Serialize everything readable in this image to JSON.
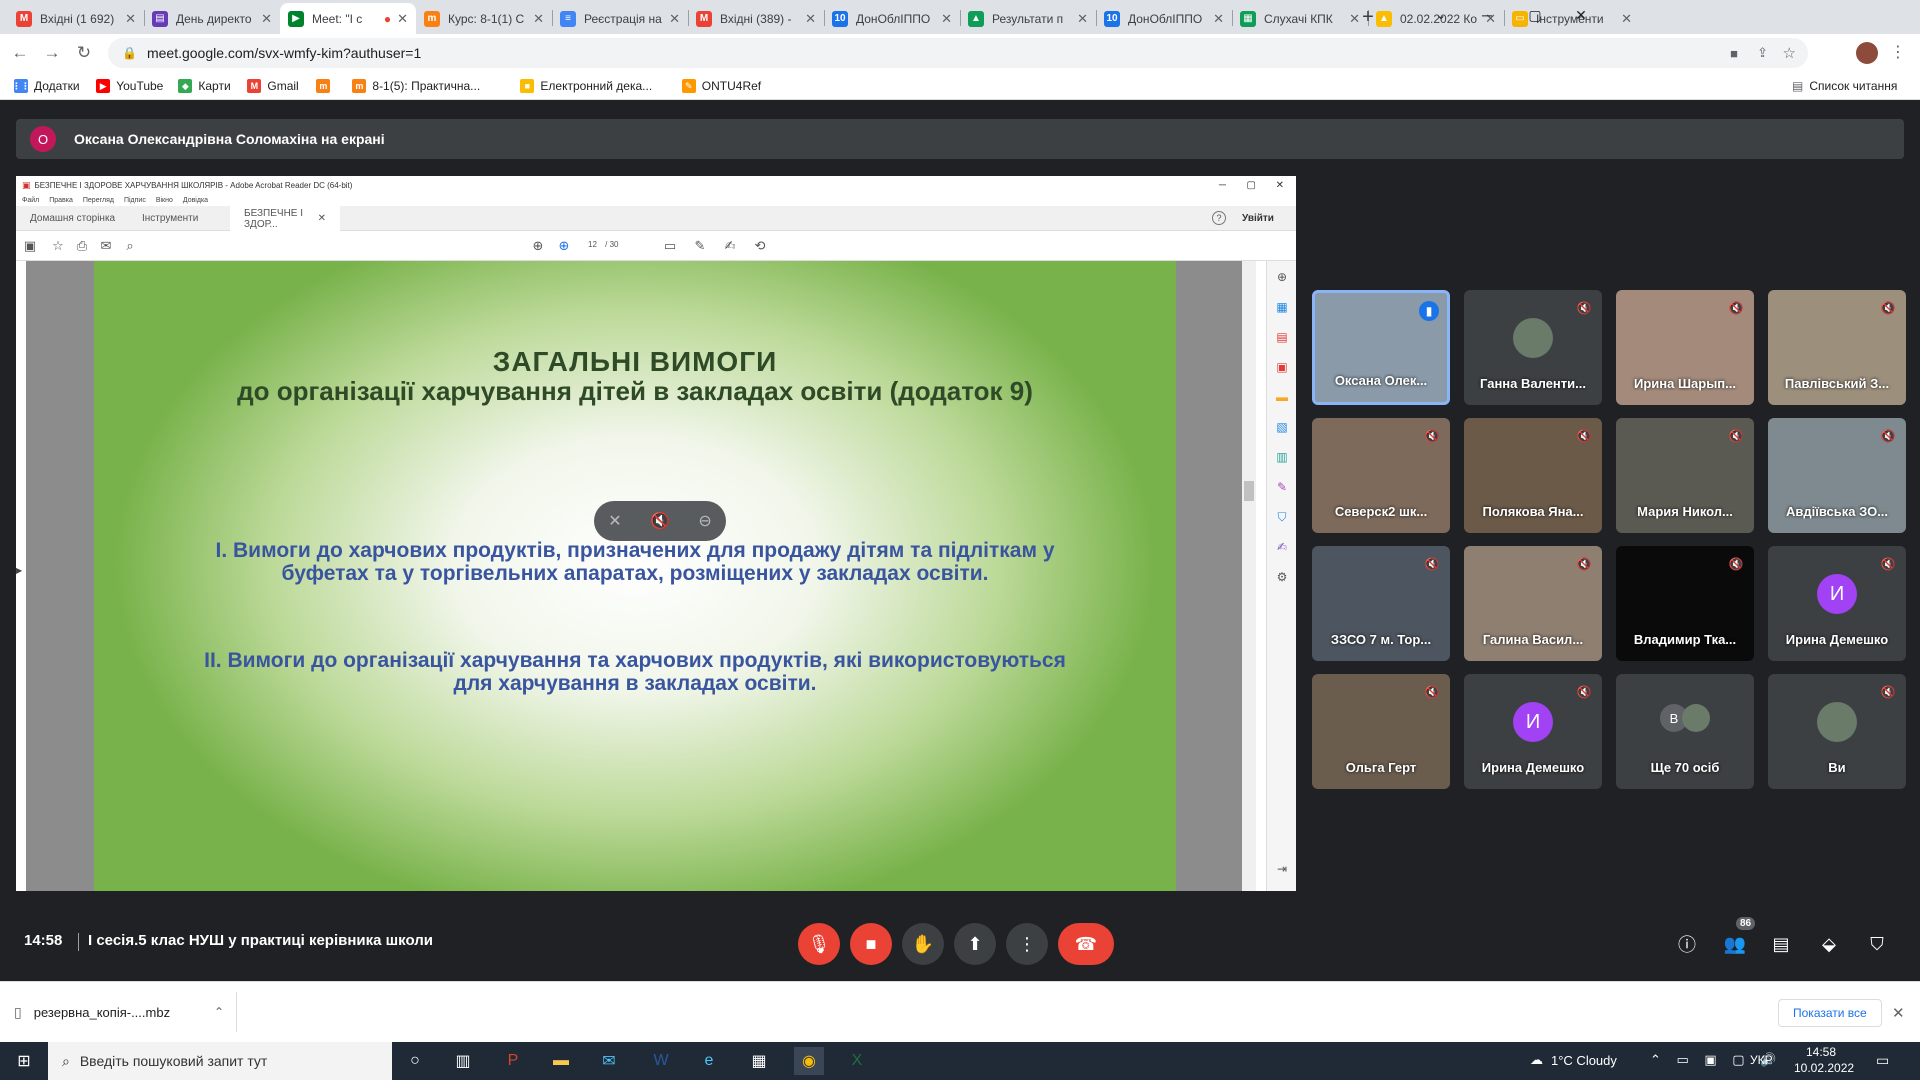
{
  "browser": {
    "tabs": [
      {
        "title": "Вхідні (1 692)",
        "icon": "gmail-icon",
        "color": "#ea4335",
        "glyph": "M"
      },
      {
        "title": "День директо",
        "icon": "forms-icon",
        "color": "#673ab7",
        "glyph": "▤"
      },
      {
        "title": "Meet: \"I с",
        "icon": "meet-icon",
        "color": "#00832d",
        "glyph": "▶",
        "active": true
      },
      {
        "title": "Курс: 8-1(1) С",
        "icon": "moodle-icon",
        "color": "#f98012",
        "glyph": "m"
      },
      {
        "title": "Реєстрація на",
        "icon": "reg-icon",
        "color": "#4285f4",
        "glyph": "≡"
      },
      {
        "title": "Вхідні (389) -",
        "icon": "gmail-icon",
        "color": "#ea4335",
        "glyph": "M"
      },
      {
        "title": "ДонОблІППО",
        "icon": "site-icon",
        "color": "#1a73e8",
        "glyph": "10"
      },
      {
        "title": "Результати п",
        "icon": "drive-icon",
        "color": "#0f9d58",
        "glyph": "▲"
      },
      {
        "title": "ДонОблІППО",
        "icon": "site-icon",
        "color": "#1a73e8",
        "glyph": "10"
      },
      {
        "title": "Слухачі КПК",
        "icon": "sheets-icon",
        "color": "#0f9d58",
        "glyph": "▦"
      },
      {
        "title": "02.02.2022 Ко",
        "icon": "drive-icon",
        "color": "#fbbc04",
        "glyph": "▲"
      },
      {
        "title": "Інструменти",
        "icon": "slides-icon",
        "color": "#f4b400",
        "glyph": "▭"
      }
    ],
    "new_tab": "+",
    "url": "meet.google.com/svx-wmfy-kim?authuser=1",
    "bookmarks": [
      {
        "label": "Додатки",
        "color": "#4285f4",
        "glyph": "⋮⋮"
      },
      {
        "label": "YouTube",
        "color": "#ff0000",
        "glyph": "▶"
      },
      {
        "label": "Карти",
        "color": "#34a853",
        "glyph": "◆"
      },
      {
        "label": "Gmail",
        "color": "#ea4335",
        "glyph": "M"
      },
      {
        "label": "",
        "color": "#f98012",
        "glyph": "m"
      },
      {
        "label": "8-1(5): Практична...",
        "color": "#f98012",
        "glyph": "m"
      },
      {
        "label": "Електронний дека...",
        "color": "#fbbc04",
        "glyph": "■"
      },
      {
        "label": "ONTU4Ref",
        "color": "#ff9800",
        "glyph": "✎"
      }
    ],
    "reading_list": "Список читання"
  },
  "meet": {
    "presenter_initial": "О",
    "presenter_text": "Оксана Олександрівна Соломахіна на екрані",
    "acrobat": {
      "window_title": "БЕЗПЕЧНЕ І ЗДОРОВЕ ХАРЧУВАННЯ ШКОЛЯРІВ - Adobe Acrobat Reader DC (64-bit)",
      "menu": [
        "Файл",
        "Правка",
        "Перегляд",
        "Підпис",
        "Вікно",
        "Довідка"
      ],
      "tabs": [
        "Домашня сторінка",
        "Інструменти",
        "БЕЗПЕЧНЕ І ЗДОР..."
      ],
      "signin": "Увійти",
      "page_current": "12",
      "page_total": "/ 30"
    },
    "slide": {
      "title": "ЗАГАЛЬНІ ВИМОГИ",
      "subtitle": "до організації харчування дітей в закладах освіти (додаток 9)",
      "item1_line1": "І. Вимоги до харчових продуктів, призначених для продажу дітям та підліткам у",
      "item1_line2": "буфетах та у торгівельних апаратах, розміщених у закладах освіти.",
      "item2_line1": "ІІ. Вимоги до організації харчування та харчових продуктів, які використовуються",
      "item2_line2": "для харчування в закладах освіти."
    },
    "participants": [
      {
        "name": "Оксана Олек...",
        "speaking": true,
        "bg": "#8a9aa8"
      },
      {
        "name": "Ганна Валенти...",
        "avatar": "photo",
        "bg": "#3c4043"
      },
      {
        "name": "Ирина Шарып...",
        "bg": "#a38a7a"
      },
      {
        "name": "Павлівський З...",
        "bg": "#9c8f7c"
      },
      {
        "name": "Северск2 шк...",
        "bg": "#7d6a5b"
      },
      {
        "name": "Полякова Яна...",
        "bg": "#6b5a48"
      },
      {
        "name": "Мария Никол...",
        "bg": "#5a5a52"
      },
      {
        "name": "Авдіївська ЗО...",
        "bg": "#7e8a8f"
      },
      {
        "name": "ЗЗСО 7 м. Тор...",
        "bg": "#4d5560"
      },
      {
        "name": "Галина Васил...",
        "bg": "#8f7f70"
      },
      {
        "name": "Владимир Тка...",
        "bg": "#0a0a0a"
      },
      {
        "name": "Ирина Демешко",
        "avatar": "И",
        "bg": "#3c4043"
      },
      {
        "name": "Ольга Герт",
        "bg": "#6a5d4e"
      },
      {
        "name": "Ирина Демешко",
        "avatar": "И",
        "bg": "#3c4043"
      },
      {
        "name": "Ще 70 осіб",
        "more": "В",
        "bg": "#3c4043"
      },
      {
        "name": "Ви",
        "avatar": "photo",
        "bg": "#3c4043"
      }
    ],
    "time": "14:58",
    "meeting_title": "І сесія.5 клас НУШ у практиці керівника школи",
    "people_count": "86"
  },
  "downloads": {
    "file": "резервна_копія-....mbz",
    "show_all": "Показати все"
  },
  "taskbar": {
    "search_placeholder": "Введіть пошуковий запит тут",
    "weather": "1°C  Cloudy",
    "lang": "УКР",
    "time": "14:58",
    "date": "10.02.2022"
  },
  "colors": {
    "end_call": "#ea4335",
    "mic_off": "#ea4335",
    "meet_bg": "#202124",
    "purple_avatar": "#a142f4"
  }
}
